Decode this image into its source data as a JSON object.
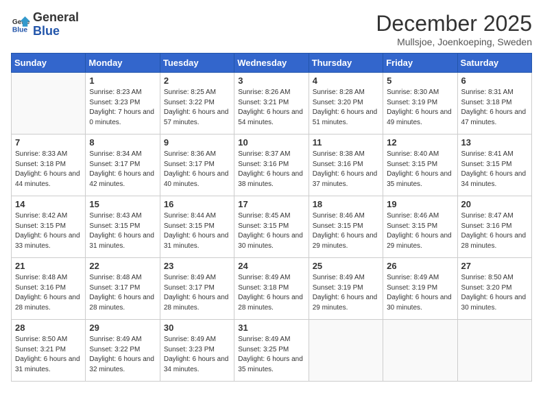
{
  "header": {
    "logo_general": "General",
    "logo_blue": "Blue",
    "month_title": "December 2025",
    "location": "Mullsjoe, Joenkoeping, Sweden"
  },
  "weekdays": [
    "Sunday",
    "Monday",
    "Tuesday",
    "Wednesday",
    "Thursday",
    "Friday",
    "Saturday"
  ],
  "weeks": [
    [
      {
        "day": "",
        "info": ""
      },
      {
        "day": "1",
        "info": "Sunrise: 8:23 AM\nSunset: 3:23 PM\nDaylight: 7 hours\nand 0 minutes."
      },
      {
        "day": "2",
        "info": "Sunrise: 8:25 AM\nSunset: 3:22 PM\nDaylight: 6 hours\nand 57 minutes."
      },
      {
        "day": "3",
        "info": "Sunrise: 8:26 AM\nSunset: 3:21 PM\nDaylight: 6 hours\nand 54 minutes."
      },
      {
        "day": "4",
        "info": "Sunrise: 8:28 AM\nSunset: 3:20 PM\nDaylight: 6 hours\nand 51 minutes."
      },
      {
        "day": "5",
        "info": "Sunrise: 8:30 AM\nSunset: 3:19 PM\nDaylight: 6 hours\nand 49 minutes."
      },
      {
        "day": "6",
        "info": "Sunrise: 8:31 AM\nSunset: 3:18 PM\nDaylight: 6 hours\nand 47 minutes."
      }
    ],
    [
      {
        "day": "7",
        "info": "Sunrise: 8:33 AM\nSunset: 3:18 PM\nDaylight: 6 hours\nand 44 minutes."
      },
      {
        "day": "8",
        "info": "Sunrise: 8:34 AM\nSunset: 3:17 PM\nDaylight: 6 hours\nand 42 minutes."
      },
      {
        "day": "9",
        "info": "Sunrise: 8:36 AM\nSunset: 3:17 PM\nDaylight: 6 hours\nand 40 minutes."
      },
      {
        "day": "10",
        "info": "Sunrise: 8:37 AM\nSunset: 3:16 PM\nDaylight: 6 hours\nand 38 minutes."
      },
      {
        "day": "11",
        "info": "Sunrise: 8:38 AM\nSunset: 3:16 PM\nDaylight: 6 hours\nand 37 minutes."
      },
      {
        "day": "12",
        "info": "Sunrise: 8:40 AM\nSunset: 3:15 PM\nDaylight: 6 hours\nand 35 minutes."
      },
      {
        "day": "13",
        "info": "Sunrise: 8:41 AM\nSunset: 3:15 PM\nDaylight: 6 hours\nand 34 minutes."
      }
    ],
    [
      {
        "day": "14",
        "info": "Sunrise: 8:42 AM\nSunset: 3:15 PM\nDaylight: 6 hours\nand 33 minutes."
      },
      {
        "day": "15",
        "info": "Sunrise: 8:43 AM\nSunset: 3:15 PM\nDaylight: 6 hours\nand 31 minutes."
      },
      {
        "day": "16",
        "info": "Sunrise: 8:44 AM\nSunset: 3:15 PM\nDaylight: 6 hours\nand 31 minutes."
      },
      {
        "day": "17",
        "info": "Sunrise: 8:45 AM\nSunset: 3:15 PM\nDaylight: 6 hours\nand 30 minutes."
      },
      {
        "day": "18",
        "info": "Sunrise: 8:46 AM\nSunset: 3:15 PM\nDaylight: 6 hours\nand 29 minutes."
      },
      {
        "day": "19",
        "info": "Sunrise: 8:46 AM\nSunset: 3:15 PM\nDaylight: 6 hours\nand 29 minutes."
      },
      {
        "day": "20",
        "info": "Sunrise: 8:47 AM\nSunset: 3:16 PM\nDaylight: 6 hours\nand 28 minutes."
      }
    ],
    [
      {
        "day": "21",
        "info": "Sunrise: 8:48 AM\nSunset: 3:16 PM\nDaylight: 6 hours\nand 28 minutes."
      },
      {
        "day": "22",
        "info": "Sunrise: 8:48 AM\nSunset: 3:17 PM\nDaylight: 6 hours\nand 28 minutes."
      },
      {
        "day": "23",
        "info": "Sunrise: 8:49 AM\nSunset: 3:17 PM\nDaylight: 6 hours\nand 28 minutes."
      },
      {
        "day": "24",
        "info": "Sunrise: 8:49 AM\nSunset: 3:18 PM\nDaylight: 6 hours\nand 28 minutes."
      },
      {
        "day": "25",
        "info": "Sunrise: 8:49 AM\nSunset: 3:19 PM\nDaylight: 6 hours\nand 29 minutes."
      },
      {
        "day": "26",
        "info": "Sunrise: 8:49 AM\nSunset: 3:19 PM\nDaylight: 6 hours\nand 30 minutes."
      },
      {
        "day": "27",
        "info": "Sunrise: 8:50 AM\nSunset: 3:20 PM\nDaylight: 6 hours\nand 30 minutes."
      }
    ],
    [
      {
        "day": "28",
        "info": "Sunrise: 8:50 AM\nSunset: 3:21 PM\nDaylight: 6 hours\nand 31 minutes."
      },
      {
        "day": "29",
        "info": "Sunrise: 8:49 AM\nSunset: 3:22 PM\nDaylight: 6 hours\nand 32 minutes."
      },
      {
        "day": "30",
        "info": "Sunrise: 8:49 AM\nSunset: 3:23 PM\nDaylight: 6 hours\nand 34 minutes."
      },
      {
        "day": "31",
        "info": "Sunrise: 8:49 AM\nSunset: 3:25 PM\nDaylight: 6 hours\nand 35 minutes."
      },
      {
        "day": "",
        "info": ""
      },
      {
        "day": "",
        "info": ""
      },
      {
        "day": "",
        "info": ""
      }
    ]
  ]
}
